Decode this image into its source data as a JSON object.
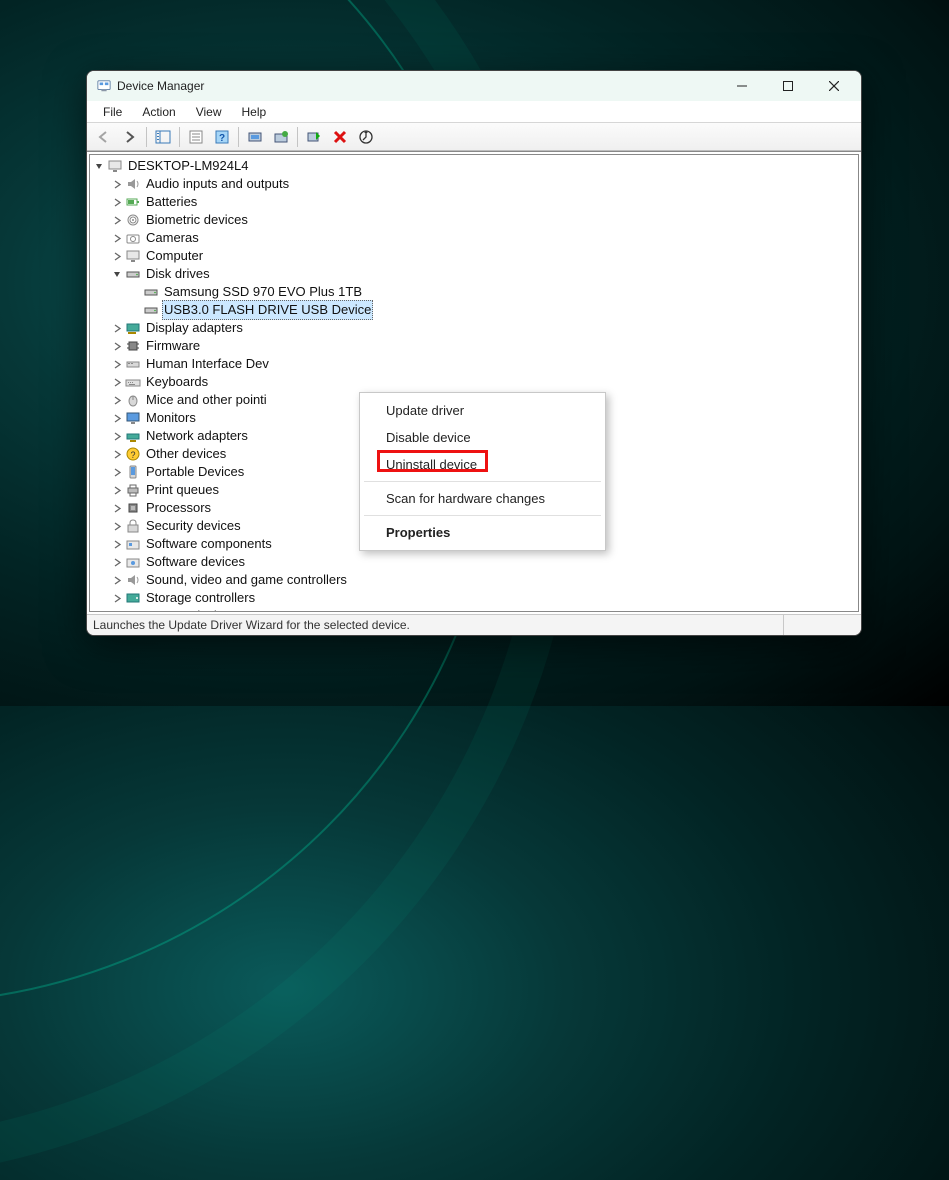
{
  "window": {
    "title": "Device Manager"
  },
  "menubar": {
    "file": "File",
    "action": "Action",
    "view": "View",
    "help": "Help"
  },
  "tree": {
    "root": "DESKTOP-LM924L4",
    "categories": {
      "audio": "Audio inputs and outputs",
      "batteries": "Batteries",
      "biometric": "Biometric devices",
      "cameras": "Cameras",
      "computer": "Computer",
      "disk_drives": "Disk drives",
      "display": "Display adapters",
      "firmware": "Firmware",
      "hid": "Human Interface Dev",
      "keyboards": "Keyboards",
      "mice": "Mice and other pointi",
      "monitors": "Monitors",
      "network": "Network adapters",
      "other": "Other devices",
      "portable": "Portable Devices",
      "print": "Print queues",
      "processors": "Processors",
      "security": "Security devices",
      "swcomp": "Software components",
      "swdev": "Software devices",
      "sound": "Sound, video and game controllers",
      "storage": "Storage controllers",
      "system": "System devices"
    },
    "disk_children": {
      "ssd": "Samsung SSD 970 EVO Plus 1TB",
      "usb": "USB3.0 FLASH DRIVE USB Device"
    }
  },
  "context_menu": {
    "update": "Update driver",
    "disable": "Disable device",
    "uninstall": "Uninstall device",
    "scan": "Scan for hardware changes",
    "properties": "Properties"
  },
  "statusbar": {
    "text": "Launches the Update Driver Wizard for the selected device."
  }
}
